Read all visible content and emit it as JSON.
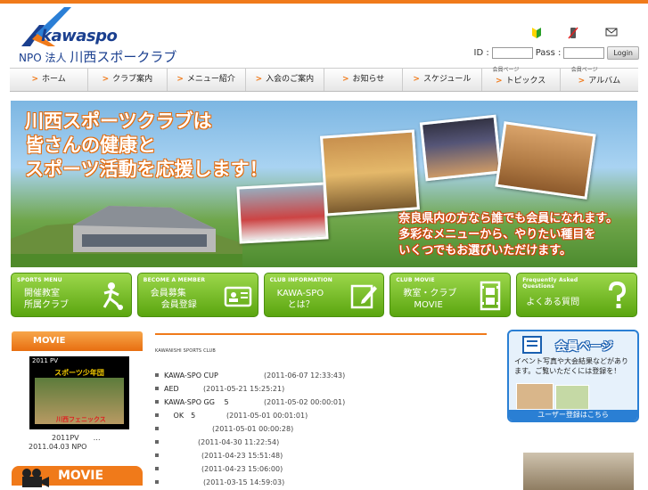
{
  "header": {
    "brand": "kawaspo",
    "org_prefix": "NPO 法人",
    "org_name": "川西スポークラブ",
    "login": {
      "id_label": "ID :",
      "pass_label": "Pass :",
      "button": "Login",
      "id_value": "",
      "pass_value": ""
    },
    "icons": [
      "beginner-mark-icon",
      "no-phone-icon",
      "mail-icon"
    ]
  },
  "nav": {
    "items": [
      {
        "label": "ホーム",
        "sub": ""
      },
      {
        "label": "クラブ案内",
        "sub": ""
      },
      {
        "label": "メニュー紹介",
        "sub": ""
      },
      {
        "label": "入会のご案内",
        "sub": ""
      },
      {
        "label": "お知らせ",
        "sub": ""
      },
      {
        "label": "スケジュール",
        "sub": ""
      },
      {
        "label": "トピックス",
        "sub": "会員ページ"
      },
      {
        "label": "アルバム",
        "sub": "会員ページ"
      }
    ]
  },
  "hero": {
    "headline": [
      "川西スポーツクラブは",
      "皆さんの健康と",
      "スポーツ活動を応援します！"
    ],
    "subline": [
      "奈良県内の方なら誰でも会員になれます。",
      "多彩なメニューから、やりたい種目を",
      "いくつでもお選びいただけます。"
    ]
  },
  "banners": [
    {
      "en": "SPORTS MENU",
      "jp": [
        "開催教室",
        "所属クラブ"
      ],
      "icon": "soccer-player-icon"
    },
    {
      "en": "BECOME A MEMBER",
      "jp": [
        "会員募集",
        "会員登録"
      ],
      "icon": "member-card-icon"
    },
    {
      "en": "CLUB INFORMATION",
      "jp": [
        "KAWA-SPO",
        "とは？"
      ],
      "icon": "pencil-note-icon"
    },
    {
      "en": "CLUB MOVIE",
      "jp": [
        "教室・クラブ",
        "MOVIE"
      ],
      "icon": "film-strip-icon"
    },
    {
      "en": "Frequently Asked Questions",
      "jp": [
        "よくある質問"
      ],
      "icon": "question-mark-icon"
    }
  ],
  "left": {
    "movie_heading": "MOVIE",
    "video_title": "2011 PV",
    "video_caption": "スポーツ少年団",
    "video_team": "川西フェニックス",
    "meta_line1": "2011PV",
    "meta_dots": "…",
    "meta_line2": "2011.04.03 NPO",
    "movie_banner": "MOVIE"
  },
  "center": {
    "kicker": "KAWANISHI SPORTS CLUB",
    "news": [
      {
        "title": "KAWA-SPO CUP",
        "date": "(2011-06-07 12:33:43)"
      },
      {
        "title": "AED",
        "date": "(2011-05-21 15:25:21)"
      },
      {
        "title": "KAWA-SPO GG　 5",
        "date": "(2011-05-02 00:00:01)"
      },
      {
        "title": "　 OK　5",
        "date": "(2011-05-01 00:01:01)"
      },
      {
        "title": "",
        "date": "(2011-05-01 00:00:28)"
      },
      {
        "title": "",
        "date": "(2011-04-30 11:22:54)"
      },
      {
        "title": "",
        "date": "(2011-04-23 15:51:48)"
      },
      {
        "title": "",
        "date": "(2011-04-23 15:06:00)"
      },
      {
        "title": "",
        "date": "(2011-03-15 14:59:03)"
      }
    ]
  },
  "right": {
    "member_title": "会員ページ",
    "member_desc": "イベント写真や大会結果などがあります。ご覧いただくには登録を！",
    "member_bar": "ユーザー登録はこちら"
  }
}
